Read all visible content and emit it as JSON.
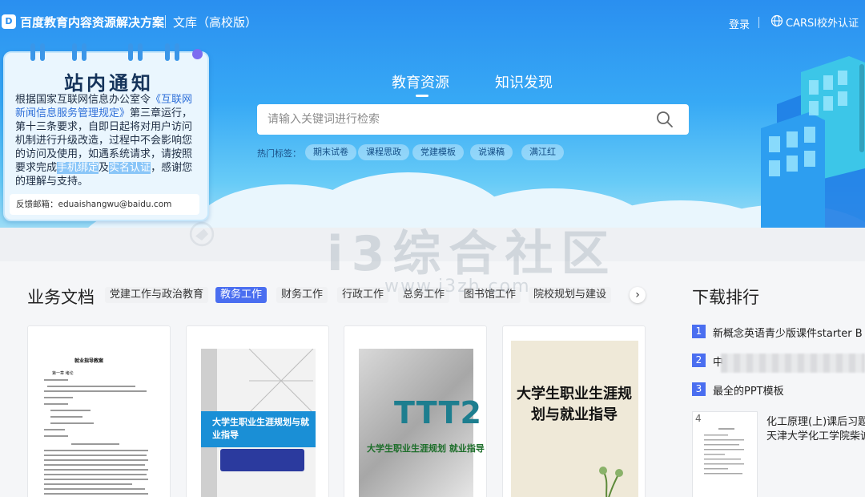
{
  "header": {
    "logo_glyph": "D",
    "brand": "百度教育内容资源解决方案",
    "product": "文库（高校版）",
    "login": "登录",
    "carsi": "CARSI校外认证"
  },
  "hero": {
    "tabs": [
      {
        "label": "教育资源",
        "active": true
      },
      {
        "label": "知识发现",
        "active": false
      }
    ],
    "search": {
      "placeholder": "请输入关键词进行检索",
      "value": ""
    },
    "hot_label": "热门标签：",
    "hot_tags": [
      "期末试卷",
      "课程思政",
      "党建模板",
      "说课稿",
      "满江红"
    ]
  },
  "notice": {
    "title": "站内通知",
    "body_1": "根据国家互联网信息办公室令",
    "body_link": "《互联网新闻信息服务管理规定》",
    "body_2": "第三章运行，第十三条要求，自即日起将对用户访问机制进行升级改造，过程中不会影响您的访问及使用，如遇系统请求，请按照要求完成",
    "hl_1": "手机绑定",
    "body_3": "及",
    "hl_2": "实名认证",
    "body_4": "，感谢您的理解与支持。",
    "feedback": "反馈邮箱：eduaishangwu@baidu.com"
  },
  "docs": {
    "title": "业务文档",
    "categories": [
      {
        "label": "党建工作与政治教育",
        "active": false
      },
      {
        "label": "教务工作",
        "active": true
      },
      {
        "label": "财务工作",
        "active": false
      },
      {
        "label": "行政工作",
        "active": false
      },
      {
        "label": "总务工作",
        "active": false
      },
      {
        "label": "图书馆工作",
        "active": false
      },
      {
        "label": "院校规划与建设",
        "active": false
      }
    ],
    "next_arrow": "›",
    "cards": [
      {
        "thumb_title": "就业指导教案",
        "thumb_sub": "第一章 绪论"
      },
      {
        "thumb_title": "大学生职业生涯规划与就业指导"
      },
      {
        "thumb_title": "大学生职业生涯规划 就业指导",
        "thumb_mark": "TTT2"
      },
      {
        "thumb_title": "大学生职业生涯规划与就业指导"
      }
    ]
  },
  "ranking": {
    "title": "下载排行",
    "items": [
      {
        "num": "1",
        "text": "新概念英语青少版课件starter B U"
      },
      {
        "num": "2",
        "text": "中"
      },
      {
        "num": "3",
        "text": "最全的PPT模板"
      },
      {
        "num": "4",
        "text": "化工原理(上)课后习题",
        "sub": "天津大学化工学院柴诚"
      }
    ]
  },
  "watermark": {
    "text": "i3综合社区",
    "url": "www.i3zh.com"
  },
  "colors": {
    "accent": "#4a6ef0",
    "hero_top": "#2a8ff0",
    "hero_bottom": "#9bdcf6"
  }
}
